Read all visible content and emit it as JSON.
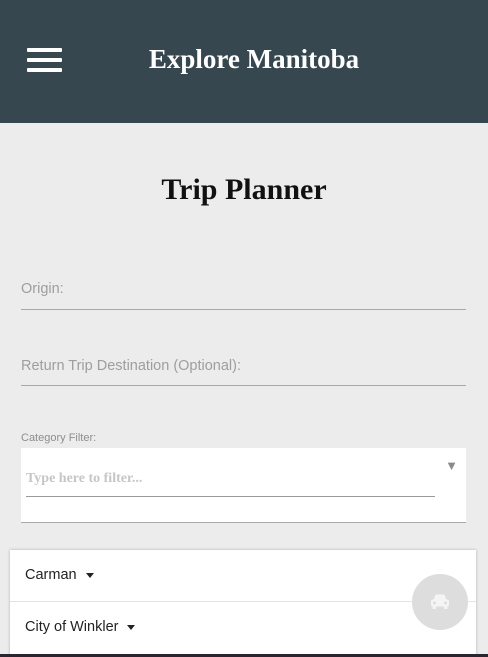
{
  "header": {
    "title": "Explore Manitoba",
    "menu_icon": "hamburger-menu-icon",
    "background": "#36474f"
  },
  "page": {
    "title": "Trip Planner"
  },
  "form": {
    "origin_label": "Origin:",
    "return_label": "Return Trip Destination (Optional):",
    "category_label": "Category Filter:",
    "filter_placeholder": "Type here to filter...",
    "filter_arrow": "▼"
  },
  "destinations": [
    {
      "label": "Carman"
    },
    {
      "label": "City of Winkler"
    }
  ],
  "fab": {
    "icon": "car-icon"
  }
}
